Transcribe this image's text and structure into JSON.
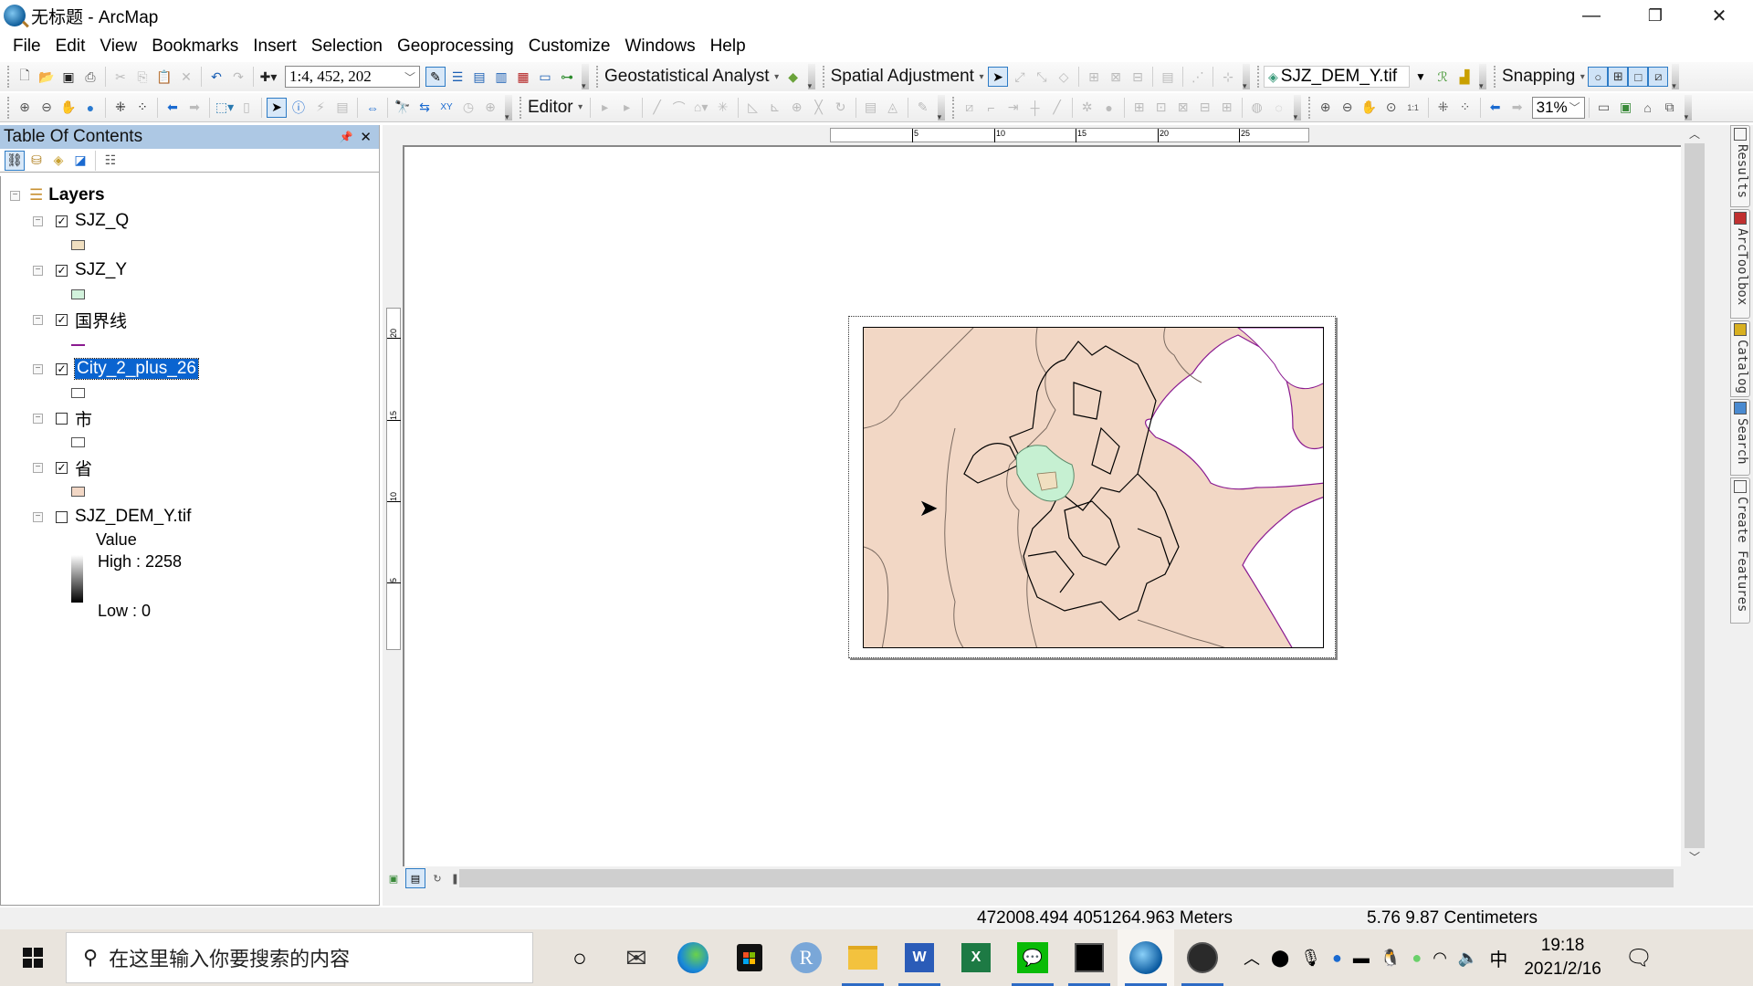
{
  "window": {
    "title": "无标题 - ArcMap",
    "controls": [
      "minimize",
      "restore",
      "close"
    ]
  },
  "menu": [
    "File",
    "Edit",
    "View",
    "Bookmarks",
    "Insert",
    "Selection",
    "Geoprocessing",
    "Customize",
    "Windows",
    "Help"
  ],
  "toolbar1": {
    "scale": "1:4, 452, 202",
    "geostatistical_label": "Geostatistical Analyst",
    "spatial_adjustment_label": "Spatial Adjustment",
    "layer_combo": "SJZ_DEM_Y.tif",
    "snapping_label": "Snapping"
  },
  "toolbar2": {
    "editor_label": "Editor",
    "zoom_percent": "31%"
  },
  "toc": {
    "title": "Table Of Contents",
    "root": "Layers",
    "layers": [
      {
        "name": "SJZ_Q",
        "checked": true,
        "swatch": "#f0dfc0",
        "type": "fill"
      },
      {
        "name": "SJZ_Y",
        "checked": true,
        "swatch": "#d2f2dc",
        "type": "fill"
      },
      {
        "name": "国界线",
        "checked": true,
        "swatch": "#8a1a90",
        "type": "line"
      },
      {
        "name": "City_2_plus_26",
        "checked": true,
        "swatch": "#ffffff",
        "type": "fill",
        "selected": true
      },
      {
        "name": "市",
        "checked": false,
        "swatch": "#ffffff",
        "type": "fill"
      },
      {
        "name": "省",
        "checked": true,
        "swatch": "#f2d7c5",
        "type": "fill"
      },
      {
        "name": "SJZ_DEM_Y.tif",
        "checked": false,
        "type": "raster"
      }
    ],
    "raster_legend": {
      "field": "Value",
      "high": "High : 2258",
      "low": "Low : 0"
    }
  },
  "rulers": {
    "horizontal": [
      "5",
      "10",
      "15",
      "20",
      "25"
    ],
    "vertical": [
      "20",
      "15",
      "10",
      "5"
    ]
  },
  "dock_tabs": [
    "Results",
    "ArcToolbox",
    "Catalog",
    "Search",
    "Create Features"
  ],
  "status": {
    "map_coords": "472008.494  4051264.963 Meters",
    "page_coords": "5.76  9.87 Centimeters"
  },
  "taskbar": {
    "search_placeholder": "在这里输入你要搜索的内容",
    "ime": "中",
    "time": "19:18",
    "date": "2021/2/16"
  }
}
